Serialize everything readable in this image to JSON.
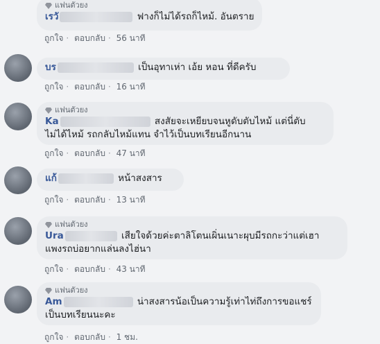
{
  "badge": "แฟนตัวยง",
  "actions": {
    "like": "ถูกใจ",
    "reply": "ตอบกลับ",
    "sep": "·"
  },
  "comments": [
    {
      "name": "เรวั",
      "text1": "ฟางก็ไม่ได้รถก็ไหม้. อันตราย",
      "text2": "",
      "time": "56 นาที",
      "fan": true
    },
    {
      "name": "บร",
      "text1": "เป็นอุทาเห่า เอ้ย หอน ที่ดีครับ",
      "text2": "",
      "time": "16 นาที",
      "fan": false
    },
    {
      "name": "Ka",
      "text1": "สงสัยจะเหยียบจนหูดับตับไหม้ แต่นี่ตับ",
      "text2": "ไม่ได้ไหม้ รถกลับไหม้แทน จำไว้เป็นบทเรียนอีกนาน",
      "time": "47 นาที",
      "fan": true
    },
    {
      "name": "แก้",
      "text1": "หน้าสงสาร",
      "text2": "",
      "time": "13 นาที",
      "fan": false
    },
    {
      "name": "Ura",
      "text1": "เสียใจด้วยค่ะตาลิโตนเผิ่นเนาะผุบมีรถกะว่าแต่เฮา",
      "text2": "แพงรถบ่อยากแล่นลงไฮ่นา",
      "time": "43 นาที",
      "fan": true
    },
    {
      "name": "Am",
      "text1": "น่าสงสารน้อเป็นความรู้เท่าไท่ถึงการขอแชร์",
      "text2": "เป็นบทเรียนนะคะ",
      "time": "1 ชม.",
      "fan": true
    }
  ]
}
